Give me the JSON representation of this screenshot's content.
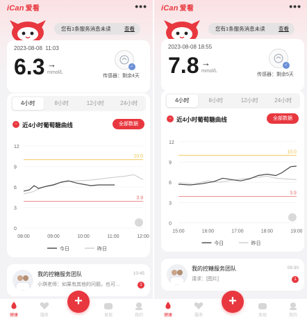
{
  "logo": {
    "text": "iCan",
    "suffix": "爱看"
  },
  "menu": {
    "dots": "•••"
  },
  "notice": {
    "text": "您有1条服务消息未读",
    "action": "查看"
  },
  "sensor_label_prefix": "传感器：",
  "tabs": [
    "4小时",
    "8小时",
    "12小时",
    "24小时"
  ],
  "section_title": "近4小时葡萄糖曲线",
  "all_data_button": "全部数据",
  "legend": {
    "today": "今日",
    "yesterday": "昨日"
  },
  "team": {
    "title": "我的控糖服务团队"
  },
  "nav": [
    {
      "label": "健康",
      "icon": "drop-icon"
    },
    {
      "label": "服务",
      "icon": "heart-icon"
    },
    {
      "label": "",
      "icon": "plus-icon"
    },
    {
      "label": "发现",
      "icon": "discover-icon"
    },
    {
      "label": "我的",
      "icon": "profile-icon"
    }
  ],
  "colors": {
    "accent": "#e8373f",
    "upper_limit": "#f0c04a",
    "lower_limit": "#e86a6a",
    "today_line": "#444444",
    "yesterday_line": "#cccccc"
  },
  "screens": [
    {
      "date": "2023-08-08",
      "time": "11:03",
      "value": "6.3",
      "trend": "→",
      "unit": "mmol/L",
      "sensor_remaining": "剩余4天",
      "team_time": "10:45",
      "team_message": "小琪老师：如果有其他的问题，也可…",
      "team_badge": "1",
      "chart_data": {
        "type": "line",
        "x": [
          "08:00",
          "09:00",
          "10:00",
          "11:00",
          "12:00"
        ],
        "y_ticks": [
          0,
          3,
          6,
          9,
          12
        ],
        "ylim": [
          0,
          12
        ],
        "upper_limit": 10.0,
        "lower_limit": 3.9,
        "upper_label": "10.0",
        "lower_label": "3.9",
        "series": [
          {
            "name": "今日",
            "points": [
              [
                0,
                5.4
              ],
              [
                0.2,
                5.6
              ],
              [
                0.35,
                6.2
              ],
              [
                0.5,
                5.8
              ],
              [
                0.75,
                6.1
              ],
              [
                1.0,
                6.3
              ],
              [
                1.25,
                6.7
              ],
              [
                1.5,
                6.9
              ],
              [
                1.75,
                6.6
              ],
              [
                2.0,
                6.4
              ],
              [
                2.25,
                6.2
              ],
              [
                2.5,
                6.3
              ],
              [
                2.75,
                6.3
              ],
              [
                3.05,
                6.3
              ]
            ]
          },
          {
            "name": "昨日",
            "points": [
              [
                0,
                5.0
              ],
              [
                0.3,
                5.3
              ],
              [
                0.6,
                5.9
              ],
              [
                1.0,
                6.4
              ],
              [
                1.4,
                6.8
              ],
              [
                1.8,
                6.9
              ],
              [
                2.2,
                7.0
              ],
              [
                2.6,
                7.2
              ],
              [
                3.0,
                7.4
              ],
              [
                3.4,
                7.6
              ],
              [
                3.7,
                7.8
              ],
              [
                3.9,
                7.3
              ],
              [
                4.0,
                7.1
              ]
            ]
          }
        ]
      }
    },
    {
      "date": "2023-08-08",
      "time": "18:55",
      "value": "7.8",
      "trend": "→",
      "unit": "mmol/L",
      "sensor_remaining": "剩余5天",
      "team_time": "09:30",
      "team_message": "请求：[图片]",
      "team_badge": "1",
      "chart_data": {
        "type": "line",
        "x": [
          "15:00",
          "16:00",
          "17:00",
          "18:00",
          "19:00"
        ],
        "y_ticks": [
          0,
          3,
          6,
          9,
          12
        ],
        "ylim": [
          0,
          12
        ],
        "upper_limit": 10.0,
        "lower_limit": 3.9,
        "upper_label": "10.0",
        "lower_label": "3.9",
        "series": [
          {
            "name": "今日",
            "points": [
              [
                0,
                5.7
              ],
              [
                0.4,
                5.6
              ],
              [
                0.8,
                5.8
              ],
              [
                1.2,
                6.1
              ],
              [
                1.5,
                6.6
              ],
              [
                1.8,
                6.4
              ],
              [
                2.1,
                6.2
              ],
              [
                2.4,
                6.5
              ],
              [
                2.7,
                7.0
              ],
              [
                3.0,
                7.2
              ],
              [
                3.3,
                7.0
              ],
              [
                3.5,
                7.4
              ],
              [
                3.8,
                8.3
              ],
              [
                4.0,
                8.4
              ]
            ]
          },
          {
            "name": "昨日",
            "points": [
              [
                0,
                5.9
              ],
              [
                0.5,
                5.7
              ],
              [
                1.0,
                6.2
              ],
              [
                1.4,
                6.0
              ],
              [
                1.8,
                6.3
              ],
              [
                2.2,
                6.5
              ],
              [
                2.6,
                6.7
              ],
              [
                3.0,
                6.9
              ],
              [
                3.3,
                6.6
              ],
              [
                3.6,
                6.5
              ],
              [
                4.0,
                6.4
              ]
            ]
          }
        ]
      }
    }
  ]
}
